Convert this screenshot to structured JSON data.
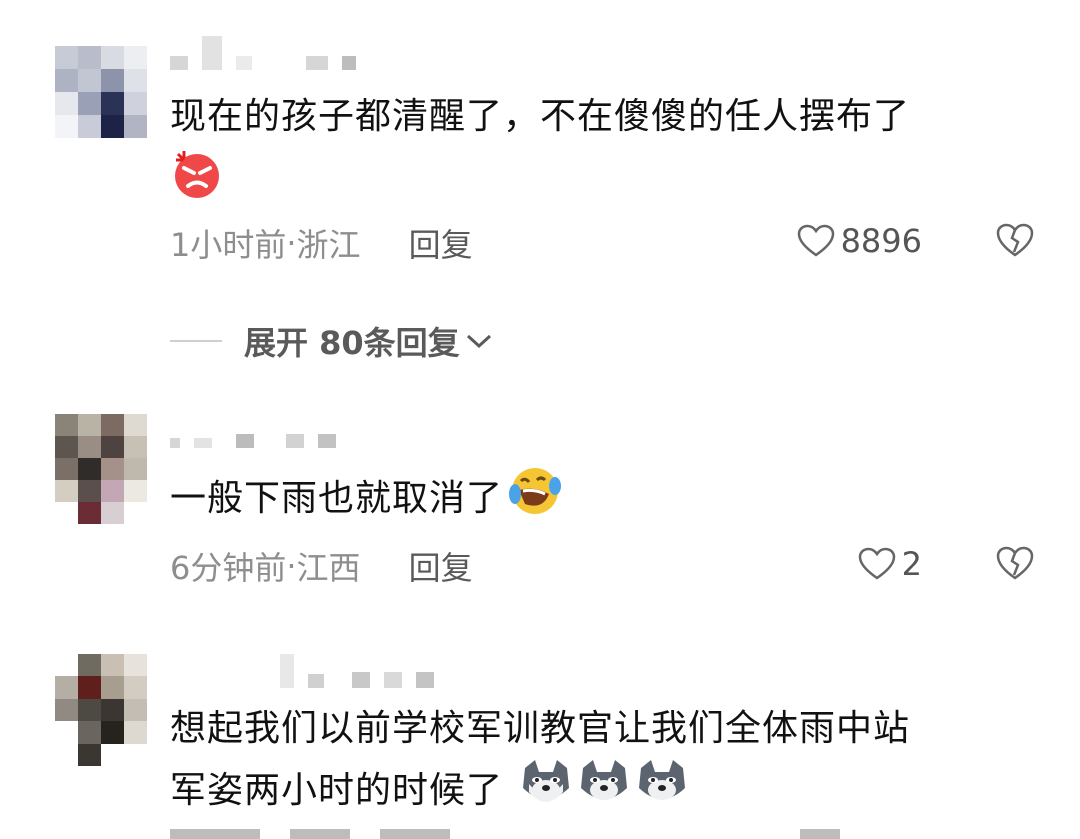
{
  "comments": [
    {
      "text": "现在的孩子都清醒了，不在傻傻的任人摆布了",
      "emoji": [
        "angry-red-face"
      ],
      "time": "1小时前",
      "location": "浙江",
      "reply": "回复",
      "likes": "8896"
    },
    {
      "text": "一般下雨也就取消了",
      "emoji": [
        "rolling-laughing-face"
      ],
      "time": "6分钟前",
      "location": "江西",
      "reply": "回复",
      "likes": "2"
    },
    {
      "text_line1": "想起我们以前学校军训教官让我们全体雨中站",
      "text_line2": "军姿两小时的时候了",
      "emoji": [
        "doge-face",
        "doge-face",
        "doge-face"
      ]
    }
  ],
  "expand_replies": "展开 80条回复",
  "separator": " · ",
  "colors": {
    "text": "#111111",
    "meta": "#8e8e8e",
    "reply": "#5a5a5a"
  }
}
